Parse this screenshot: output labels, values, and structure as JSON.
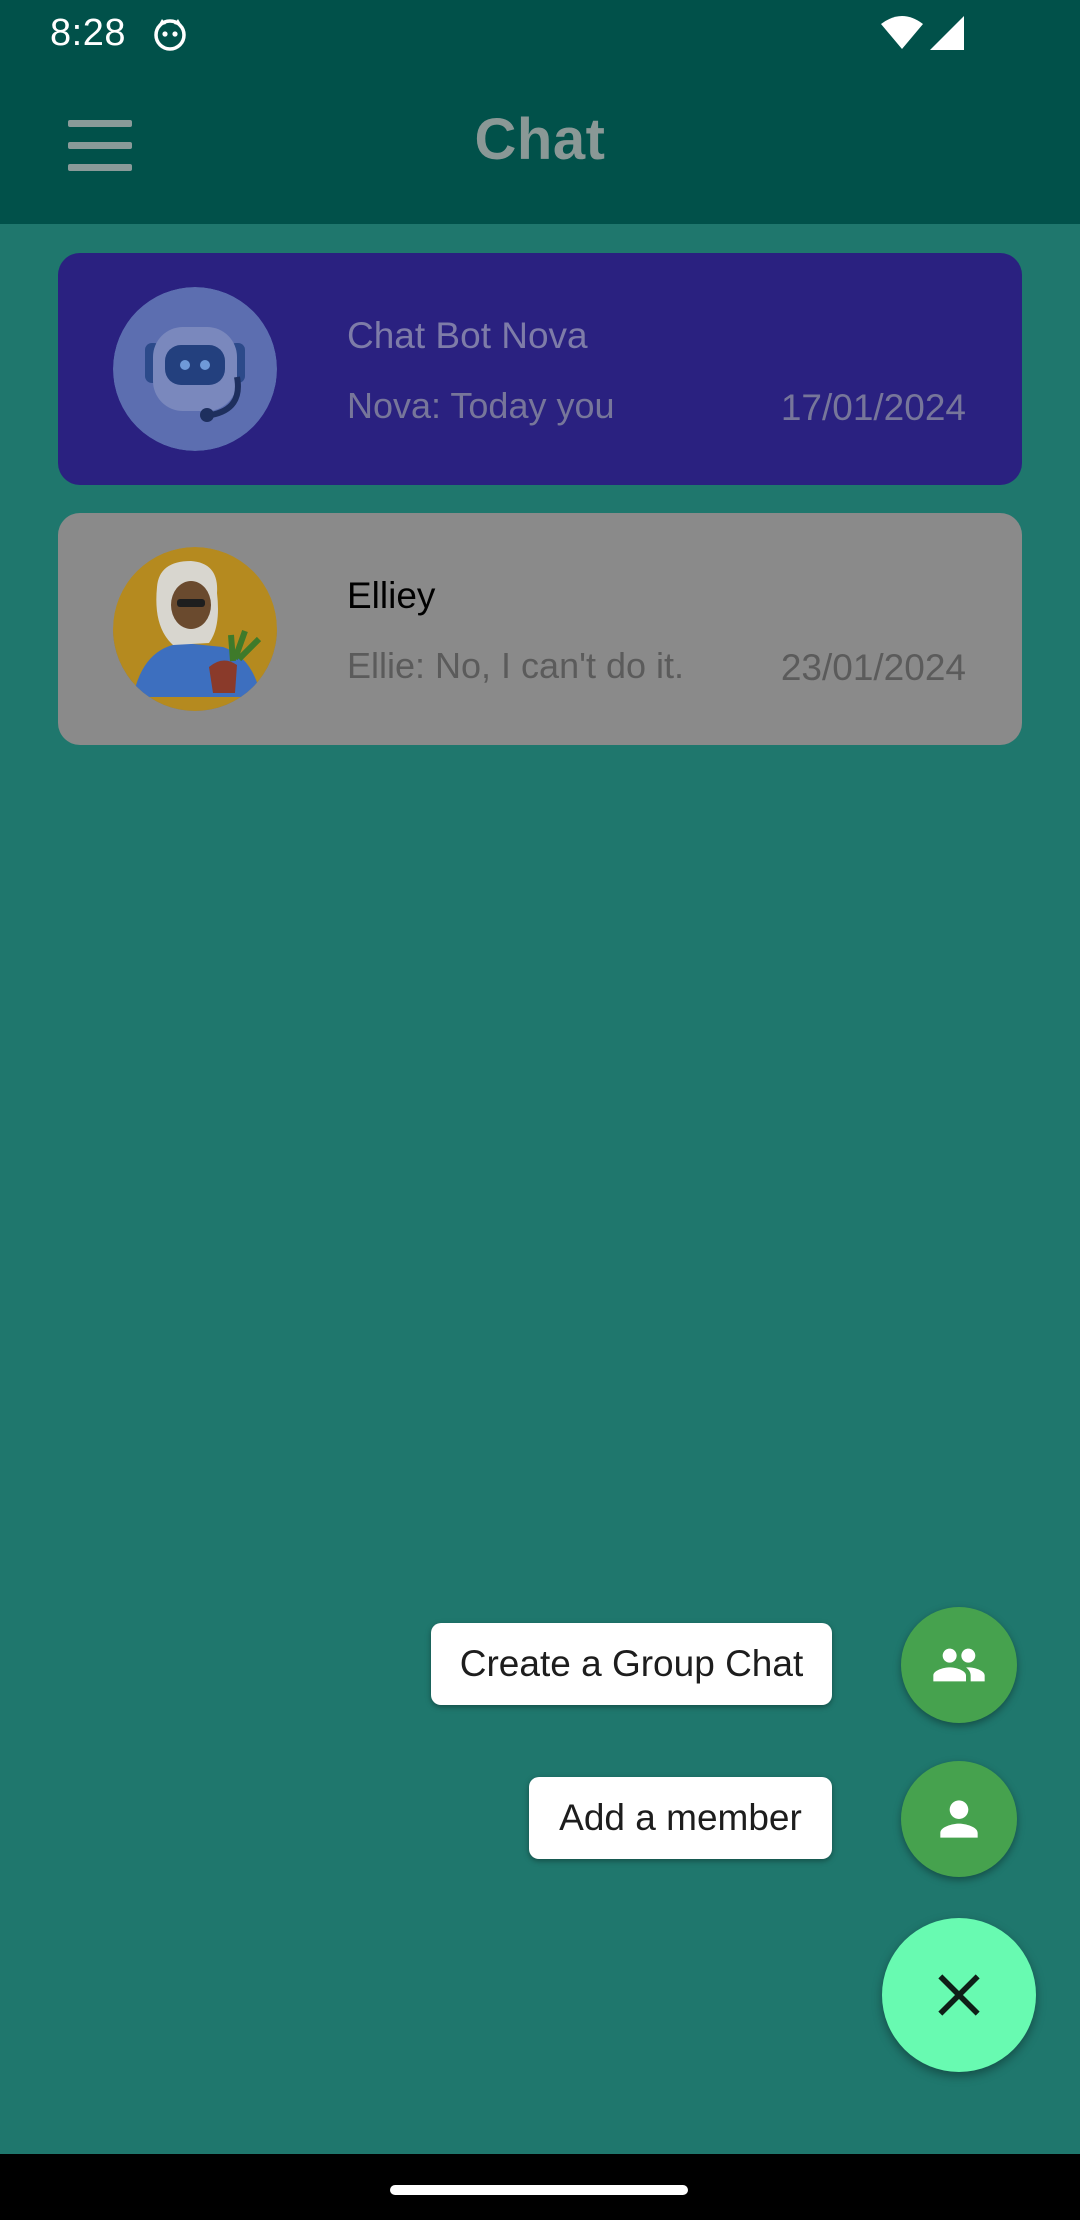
{
  "status_bar": {
    "time": "8:28",
    "icons": [
      "cat-icon",
      "wifi-icon",
      "signal-icon"
    ]
  },
  "app_bar": {
    "title": "Chat",
    "menu_icon": "hamburger-menu-icon"
  },
  "chats": [
    {
      "name": "Chat Bot Nova",
      "preview": "Nova: Today you",
      "date": "17/01/2024",
      "avatar": "robot-avatar",
      "card_color": "#2a2180"
    },
    {
      "name": "Elliey",
      "preview": "Ellie: No, I can't do it.",
      "date": "23/01/2024",
      "avatar": "woman-avatar",
      "card_color": "#8a8a8a"
    }
  ],
  "speed_dial": {
    "group_chat_label": "Create a Group Chat",
    "group_chat_icon": "group-icon",
    "add_member_label": "Add a member",
    "add_member_icon": "person-icon",
    "close_icon": "close-icon"
  },
  "colors": {
    "background": "#1f776d",
    "app_bar": "#01514a",
    "fab_mini": "#46a24e",
    "fab_main": "#68fab1"
  }
}
